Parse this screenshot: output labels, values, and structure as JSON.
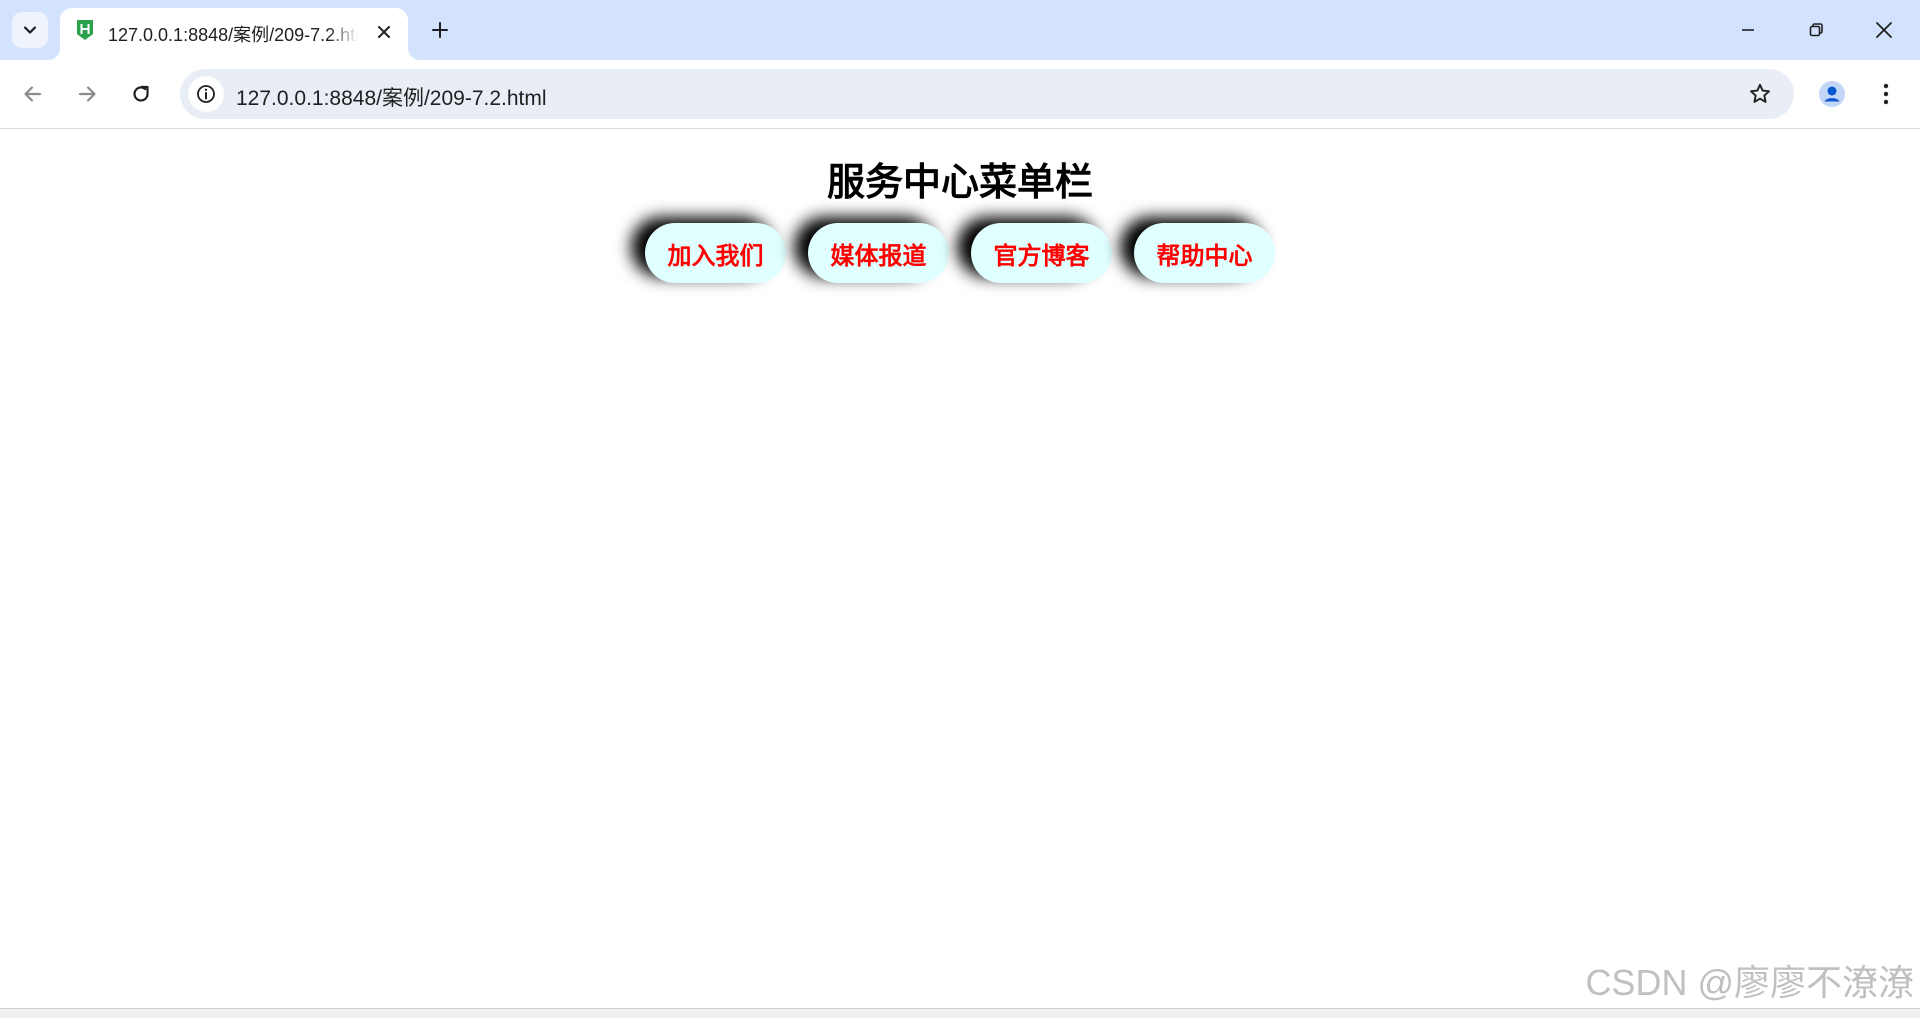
{
  "browser": {
    "tab": {
      "title": "127.0.0.1:8848/案例/209-7.2.html",
      "favicon_icon": "hbuilder-favicon-icon",
      "favicon_color": "#2aa14b"
    },
    "address_bar": {
      "url": "127.0.0.1:8848/案例/209-7.2.html"
    },
    "colors": {
      "tabstrip_bg": "#d3e3fd",
      "omnibox_bg": "#e9eef6",
      "profile_blue": "#0b57d0"
    }
  },
  "page": {
    "heading": "服务中心菜单栏",
    "menu_items": [
      {
        "label": "加入我们"
      },
      {
        "label": "媒体报道"
      },
      {
        "label": "官方博客"
      },
      {
        "label": "帮助中心"
      }
    ],
    "colors": {
      "pill_bg": "#e0ffff",
      "pill_text": "#ff0000",
      "pill_shadow": "#000000"
    }
  },
  "watermark": "CSDN @廖廖不潦潦"
}
